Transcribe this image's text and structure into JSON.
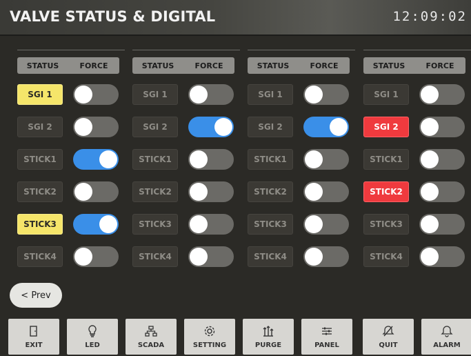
{
  "header": {
    "title": "VALVE STATUS & DIGITAL",
    "clock": "12:09:02"
  },
  "column_headers": {
    "status": "STATUS",
    "force": "FORCE"
  },
  "columns": [
    {
      "rows": [
        {
          "label": "SGI 1",
          "state": "yellow",
          "force": false
        },
        {
          "label": "SGI 2",
          "state": "off",
          "force": false
        },
        {
          "label": "STICK1",
          "state": "off",
          "force": true
        },
        {
          "label": "STICK2",
          "state": "off",
          "force": false
        },
        {
          "label": "STICK3",
          "state": "yellow",
          "force": true
        },
        {
          "label": "STICK4",
          "state": "off",
          "force": false
        }
      ]
    },
    {
      "rows": [
        {
          "label": "SGI 1",
          "state": "off",
          "force": false
        },
        {
          "label": "SGI 2",
          "state": "off",
          "force": true
        },
        {
          "label": "STICK1",
          "state": "off",
          "force": false
        },
        {
          "label": "STICK2",
          "state": "off",
          "force": false
        },
        {
          "label": "STICK3",
          "state": "off",
          "force": false
        },
        {
          "label": "STICK4",
          "state": "off",
          "force": false
        }
      ]
    },
    {
      "rows": [
        {
          "label": "SGI 1",
          "state": "off",
          "force": false
        },
        {
          "label": "SGI 2",
          "state": "off",
          "force": true
        },
        {
          "label": "STICK1",
          "state": "off",
          "force": false
        },
        {
          "label": "STICK2",
          "state": "off",
          "force": false
        },
        {
          "label": "STICK3",
          "state": "off",
          "force": false
        },
        {
          "label": "STICK4",
          "state": "off",
          "force": false
        }
      ]
    },
    {
      "rows": [
        {
          "label": "SGI 1",
          "state": "off",
          "force": false
        },
        {
          "label": "SGI 2",
          "state": "red",
          "force": false
        },
        {
          "label": "STICK1",
          "state": "off",
          "force": false
        },
        {
          "label": "STICK2",
          "state": "red",
          "force": false
        },
        {
          "label": "STICK3",
          "state": "off",
          "force": false
        },
        {
          "label": "STICK4",
          "state": "off",
          "force": false
        }
      ]
    }
  ],
  "prev_button": "< Prev",
  "footer": [
    {
      "label": "EXIT",
      "icon": "exit-door-icon"
    },
    {
      "label": "LED",
      "icon": "lightbulb-icon"
    },
    {
      "label": "SCADA",
      "icon": "network-icon"
    },
    {
      "label": "SETTING",
      "icon": "gear-icon"
    },
    {
      "label": "PURGE",
      "icon": "purge-arrows-icon"
    },
    {
      "label": "PANEL",
      "icon": "sliders-icon"
    },
    {
      "label": "QUIT",
      "icon": "bell-slash-icon"
    },
    {
      "label": "ALARM",
      "icon": "bell-icon"
    }
  ],
  "colors": {
    "status_yellow": "#f5e56a",
    "status_red": "#ef3a3e",
    "toggle_on": "#3a8fe8",
    "toggle_off": "#6b6a66"
  }
}
